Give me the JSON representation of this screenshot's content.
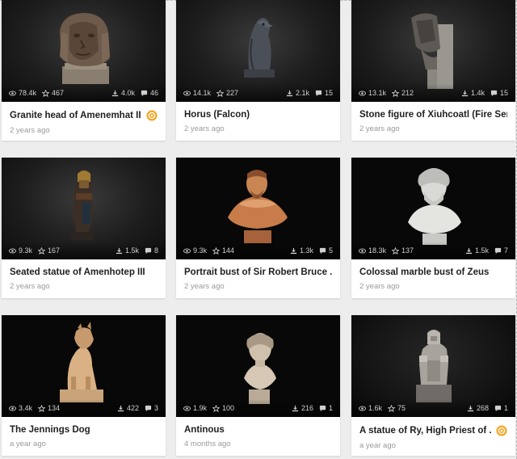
{
  "models": [
    {
      "title": "Granite head of Amenemhat III",
      "date": "2 years ago",
      "views": "78.4k",
      "likes": "467",
      "downloads": "4.0k",
      "comments": "46",
      "staff_pick": true
    },
    {
      "title": "Horus (Falcon)",
      "date": "2 years ago",
      "views": "14.1k",
      "likes": "227",
      "downloads": "2.1k",
      "comments": "15",
      "staff_pick": false
    },
    {
      "title": "Stone figure of Xiuhcoatl (Fire Ser...",
      "date": "2 years ago",
      "views": "13.1k",
      "likes": "212",
      "downloads": "1.4k",
      "comments": "15",
      "staff_pick": false
    },
    {
      "title": "Seated statue of Amenhotep III",
      "date": "2 years ago",
      "views": "9.3k",
      "likes": "167",
      "downloads": "1.5k",
      "comments": "8",
      "staff_pick": false
    },
    {
      "title": "Portrait bust of Sir Robert Bruce ...",
      "date": "2 years ago",
      "views": "9.3k",
      "likes": "144",
      "downloads": "1.3k",
      "comments": "5",
      "staff_pick": false
    },
    {
      "title": "Colossal marble bust of Zeus",
      "date": "2 years ago",
      "views": "18.3k",
      "likes": "137",
      "downloads": "1.5k",
      "comments": "7",
      "staff_pick": false
    },
    {
      "title": "The Jennings Dog",
      "date": "a year ago",
      "views": "3.4k",
      "likes": "134",
      "downloads": "422",
      "comments": "3",
      "staff_pick": false
    },
    {
      "title": "Antinous",
      "date": "4 months ago",
      "views": "1.9k",
      "likes": "100",
      "downloads": "216",
      "comments": "1",
      "staff_pick": false
    },
    {
      "title": "A statue of Ry, High Priest of ...",
      "date": "a year ago",
      "views": "1.6k",
      "likes": "75",
      "downloads": "268",
      "comments": "1",
      "staff_pick": true
    }
  ],
  "icons": {
    "views": "eye-icon",
    "likes": "star-icon",
    "downloads": "download-icon",
    "comments": "comment-icon",
    "staff_pick": "staff-pick-badge-icon"
  },
  "colors": {
    "background": "#ededed",
    "card": "#ffffff",
    "title": "#1f1f1f",
    "date": "#9a9a9a",
    "stat_text": "#cfcfcf",
    "staff_badge": "#f5a623"
  }
}
